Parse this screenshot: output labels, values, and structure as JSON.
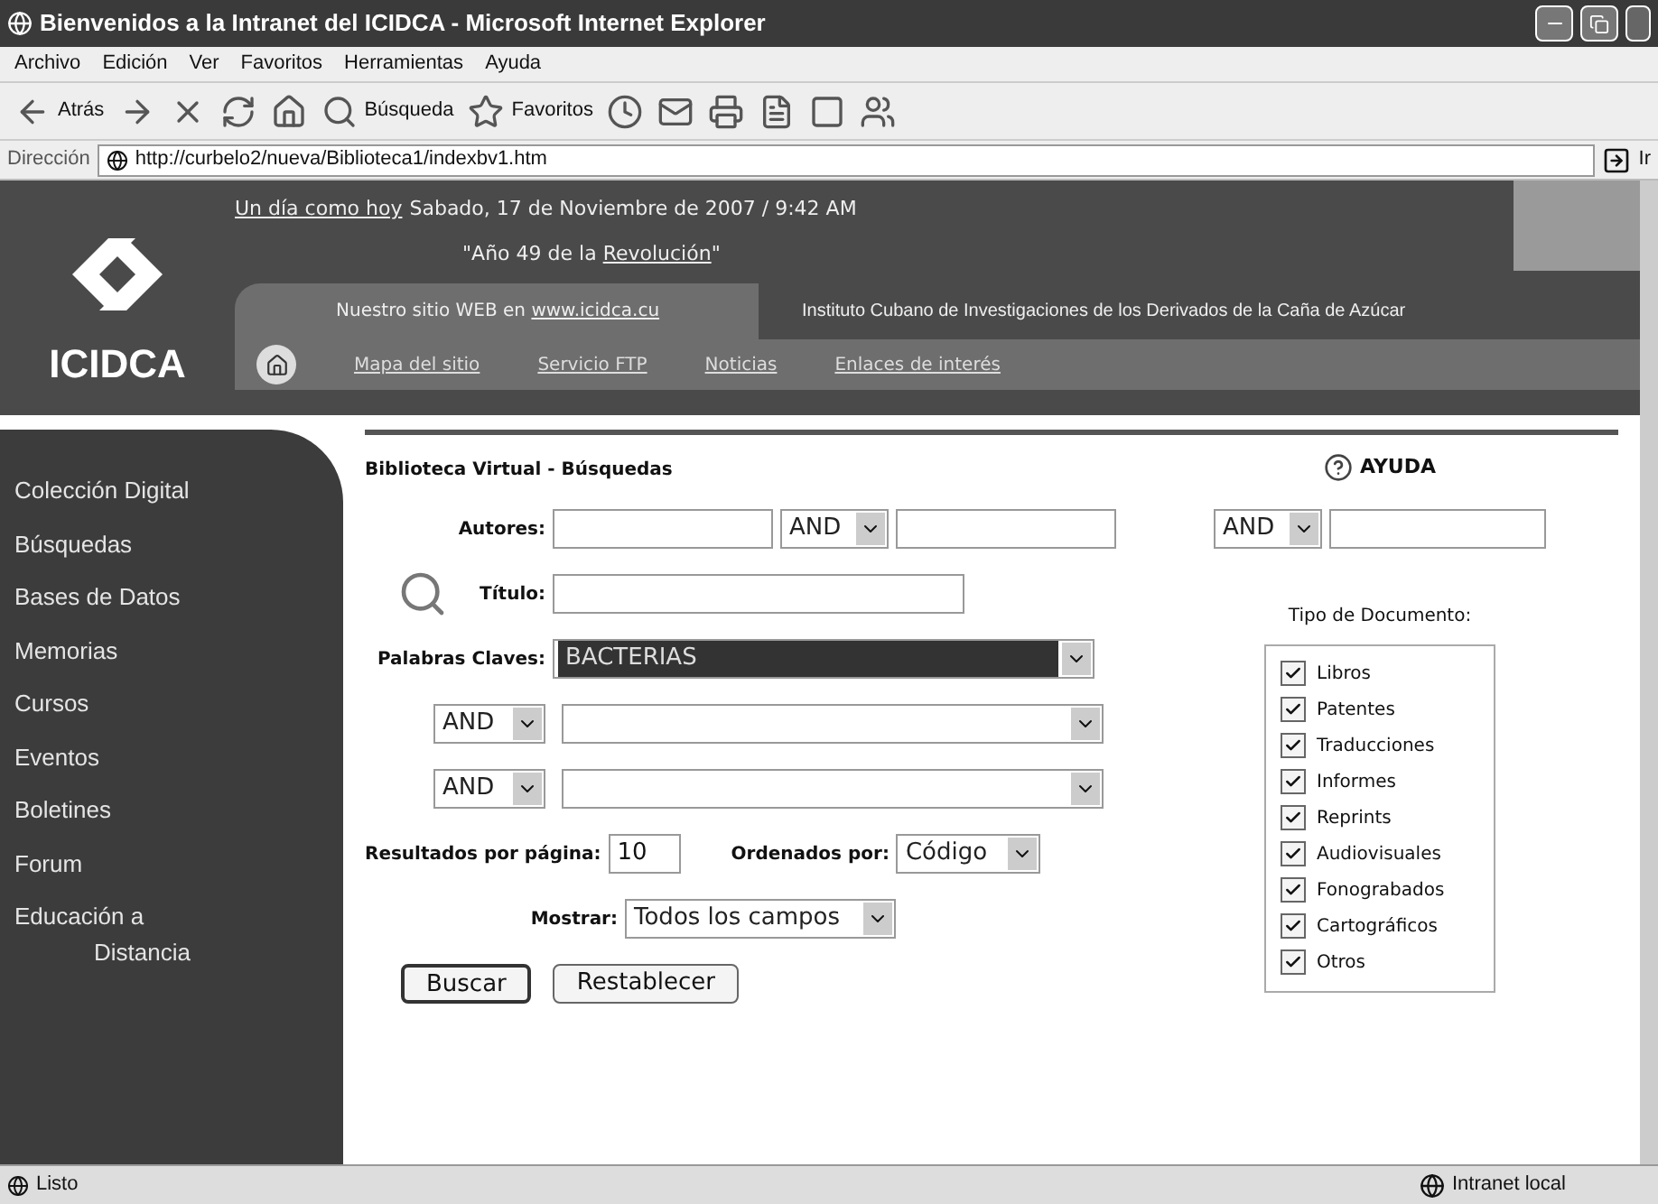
{
  "window": {
    "title": "Bienvenidos a la Intranet del ICIDCA - Microsoft Internet Explorer"
  },
  "menu": [
    "Archivo",
    "Edición",
    "Ver",
    "Favoritos",
    "Herramientas",
    "Ayuda"
  ],
  "toolbar": [
    {
      "kind": "back",
      "label": "Atrás"
    },
    {
      "kind": "forward"
    },
    {
      "kind": "stop"
    },
    {
      "kind": "refresh"
    },
    {
      "kind": "home"
    },
    {
      "kind": "search",
      "label": "Búsqueda"
    },
    {
      "kind": "favorites",
      "label": "Favoritos"
    },
    {
      "kind": "history"
    },
    {
      "kind": "mail"
    },
    {
      "kind": "print"
    },
    {
      "kind": "edit"
    },
    {
      "kind": "page"
    },
    {
      "kind": "messenger"
    }
  ],
  "address": {
    "label": "Dirección",
    "value": "http://curbelo2/nueva/Biblioteca1/indexbv1.htm",
    "go": "Ir"
  },
  "header": {
    "logo": "ICIDCA",
    "date_link": "Un día como hoy",
    "date": "Sabado, 17 de Noviembre de 2007 / 9:42 AM",
    "motto_quote": "\"Año 49 de la ",
    "motto_link": "Revolución",
    "motto_end": "\"",
    "site_text": "Nuestro sitio WEB en ",
    "site_link": "www.icidca.cu",
    "institute": "Instituto Cubano de Investigaciones de los Derivados de la Caña de Azúcar",
    "nav": [
      "Mapa del sitio",
      "Servicio FTP",
      "Noticias",
      "Enlaces de interés"
    ]
  },
  "sidebar": {
    "items": [
      {
        "lines": [
          "Colección Digital"
        ]
      },
      {
        "lines": [
          "Búsquedas"
        ]
      },
      {
        "lines": [
          "Bases de Datos"
        ]
      },
      {
        "lines": [
          "Memorias"
        ]
      },
      {
        "lines": [
          "Cursos"
        ]
      },
      {
        "lines": [
          "Eventos"
        ]
      },
      {
        "lines": [
          "Boletines"
        ]
      },
      {
        "lines": [
          "Forum"
        ]
      },
      {
        "lines": [
          "Educación a",
          "Distancia"
        ]
      }
    ]
  },
  "form": {
    "title": "Biblioteca Virtual - Búsquedas",
    "help": "AYUDA",
    "authors": {
      "label": "Autores:",
      "op1": "AND",
      "op2": "AND"
    },
    "title_field": {
      "label": "Título:"
    },
    "keywords": {
      "label": "Palabras Claves:",
      "value": "BACTERIAS",
      "focused": true,
      "rows": [
        {
          "op": "AND"
        },
        {
          "op": "AND"
        }
      ]
    },
    "per_page": {
      "label": "Resultados por página:",
      "value": "10"
    },
    "order": {
      "label": "Ordenados por:",
      "value": "Código"
    },
    "show": {
      "label": "Mostrar:",
      "value": "Todos los campos"
    },
    "buttons": [
      {
        "label": "Buscar",
        "default": true
      },
      {
        "label": "Restablecer",
        "default": false
      }
    ],
    "doc_types": {
      "label": "Tipo de Documento:",
      "items": [
        {
          "label": "Libros",
          "checked": true
        },
        {
          "label": "Patentes",
          "checked": true
        },
        {
          "label": "Traducciones",
          "checked": true
        },
        {
          "label": "Informes",
          "checked": true
        },
        {
          "label": "Reprints",
          "checked": true
        },
        {
          "label": "Audiovisuales",
          "checked": true
        },
        {
          "label": "Fonograbados",
          "checked": true
        },
        {
          "label": "Cartográficos",
          "checked": true
        },
        {
          "label": "Otros",
          "checked": true
        }
      ]
    }
  },
  "status_bar": {
    "text": "Listo",
    "zone": "Intranet local"
  }
}
